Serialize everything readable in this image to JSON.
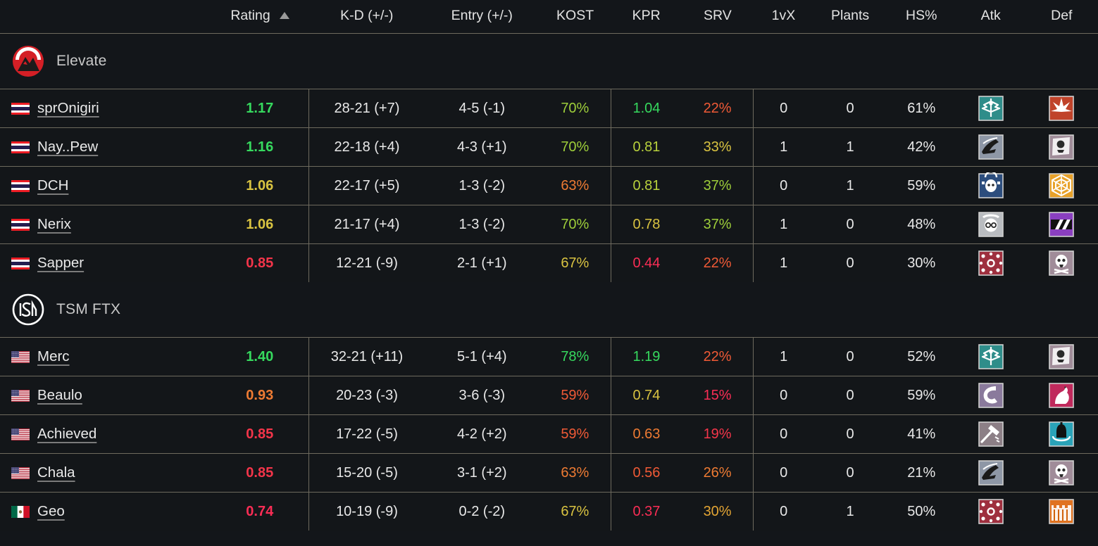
{
  "header": {
    "columns": [
      {
        "key": "name",
        "label": ""
      },
      {
        "key": "rating",
        "label": "Rating",
        "sorted": true,
        "sort_dir": "asc",
        "sort_icon": "sort-arrow-up-icon"
      },
      {
        "key": "kd",
        "label": "K-D (+/-)"
      },
      {
        "key": "entry",
        "label": "Entry (+/-)"
      },
      {
        "key": "kost",
        "label": "KOST"
      },
      {
        "key": "kpr",
        "label": "KPR"
      },
      {
        "key": "srv",
        "label": "SRV"
      },
      {
        "key": "onevx",
        "label": "1vX"
      },
      {
        "key": "plants",
        "label": "Plants"
      },
      {
        "key": "hs",
        "label": "HS%"
      },
      {
        "key": "atk",
        "label": "Atk"
      },
      {
        "key": "def",
        "label": "Def"
      }
    ]
  },
  "colors": {
    "background": "#13161a",
    "row_bg": "#131619",
    "name_cell_bg": "#0e1114",
    "border": "#6e6a5e",
    "text": "#e9e9e9",
    "green": "#36d95e",
    "green_yellow": "#9ece3a",
    "yellow": "#d9c341",
    "amber": "#e3a534",
    "orange": "#ee7b33",
    "orange_red": "#f05a36",
    "red": "#f4354a",
    "pink_red": "#fa2d55"
  },
  "teams": [
    {
      "name": "Elevate",
      "logo": "elevate-logo",
      "logo_colors": {
        "circle": "#d41f26",
        "arc": "#ffffff",
        "mountain": "#1b1b1b"
      },
      "players": [
        {
          "name": "sprOnigiri",
          "flag": "thailand-flag",
          "rating": "1.17",
          "rating_color": "#36d95e",
          "kd": "28-21 (+7)",
          "entry": "4-5 (-1)",
          "kost": "70%",
          "kost_color": "#9ece3a",
          "kpr": "1.04",
          "kpr_color": "#36d95e",
          "srv": "22%",
          "srv_color": "#f05a36",
          "onevx": "0",
          "plants": "0",
          "hs": "61%",
          "atk_op": "valkyrie-icon",
          "atk_bg": "#2f8d8a",
          "atk_glyph": "wings",
          "def_op": "ash-icon",
          "def_bg": "#c0432a",
          "def_glyph": "burst"
        },
        {
          "name": "Nay..Pew",
          "flag": "thailand-flag",
          "rating": "1.16",
          "rating_color": "#36d95e",
          "kd": "22-18 (+4)",
          "entry": "4-3 (+1)",
          "kost": "70%",
          "kost_color": "#9ece3a",
          "kpr": "0.81",
          "kpr_color": "#b8d13c",
          "srv": "33%",
          "srv_color": "#d9c341",
          "onevx": "1",
          "plants": "1",
          "hs": "42%",
          "atk_op": "nomad-icon",
          "atk_bg": "#8e97a6",
          "atk_glyph": "horse",
          "def_op": "caveira-icon",
          "def_bg": "#a08c99",
          "def_glyph": "skullflag"
        },
        {
          "name": "DCH",
          "flag": "thailand-flag",
          "rating": "1.06",
          "rating_color": "#d9c341",
          "kd": "22-17 (+5)",
          "entry": "1-3 (-2)",
          "kost": "63%",
          "kost_color": "#ee7b33",
          "kpr": "0.81",
          "kpr_color": "#b8d13c",
          "srv": "37%",
          "srv_color": "#9ece3a",
          "onevx": "0",
          "plants": "1",
          "hs": "59%",
          "atk_op": "ying-icon",
          "atk_bg": "#2c4d7d",
          "atk_glyph": "skullcan",
          "def_op": "mute-icon",
          "def_bg": "#e8a22a",
          "def_glyph": "web"
        },
        {
          "name": "Nerix",
          "flag": "thailand-flag",
          "rating": "1.06",
          "rating_color": "#d9c341",
          "kd": "21-17 (+4)",
          "entry": "1-3 (-2)",
          "kost": "70%",
          "kost_color": "#9ece3a",
          "kpr": "0.78",
          "kpr_color": "#d9c341",
          "srv": "37%",
          "srv_color": "#9ece3a",
          "onevx": "1",
          "plants": "0",
          "hs": "48%",
          "atk_op": "dokkaebi-icon",
          "atk_bg": "#b9bcc0",
          "atk_glyph": "face",
          "def_op": "mira-icon",
          "def_bg": "#8a3fc0",
          "def_glyph": "stripes"
        },
        {
          "name": "Sapper",
          "flag": "thailand-flag",
          "rating": "0.85",
          "rating_color": "#f4354a",
          "kd": "12-21 (-9)",
          "entry": "2-1 (+1)",
          "kost": "67%",
          "kost_color": "#d9c341",
          "kpr": "0.44",
          "kpr_color": "#fa2d55",
          "srv": "22%",
          "srv_color": "#f05a36",
          "onevx": "1",
          "plants": "0",
          "hs": "30%",
          "atk_op": "thatcher-icon",
          "atk_bg": "#9e2f3e",
          "atk_glyph": "dots",
          "def_op": "frost-icon",
          "def_bg": "#a08c99",
          "def_glyph": "skullbone"
        }
      ]
    },
    {
      "name": "TSM FTX",
      "logo": "tsm-logo",
      "logo_colors": {
        "circle": "#ffffff",
        "mark": "#ffffff"
      },
      "players": [
        {
          "name": "Merc",
          "flag": "usa-flag",
          "rating": "1.40",
          "rating_color": "#36d95e",
          "kd": "32-21 (+11)",
          "entry": "5-1 (+4)",
          "kost": "78%",
          "kost_color": "#36d95e",
          "kpr": "1.19",
          "kpr_color": "#36d95e",
          "srv": "22%",
          "srv_color": "#f05a36",
          "onevx": "1",
          "plants": "0",
          "hs": "52%",
          "atk_op": "valkyrie-icon",
          "atk_bg": "#2f8d8a",
          "atk_glyph": "wings",
          "def_op": "caveira-icon",
          "def_bg": "#a08c99",
          "def_glyph": "skullflag"
        },
        {
          "name": "Beaulo",
          "flag": "usa-flag",
          "rating": "0.93",
          "rating_color": "#ee7b33",
          "kd": "20-23 (-3)",
          "entry": "3-6 (-3)",
          "kost": "59%",
          "kost_color": "#f05a36",
          "kpr": "0.74",
          "kpr_color": "#d9c341",
          "srv": "15%",
          "srv_color": "#fa2d55",
          "onevx": "0",
          "plants": "0",
          "hs": "59%",
          "atk_op": "zofia-icon",
          "atk_bg": "#8a7a9c",
          "atk_glyph": "swirl",
          "def_op": "alibi-icon",
          "def_bg": "#c0295c",
          "def_glyph": "swan"
        },
        {
          "name": "Achieved",
          "flag": "usa-flag",
          "rating": "0.85",
          "rating_color": "#f4354a",
          "kd": "17-22 (-5)",
          "entry": "4-2 (+2)",
          "kost": "59%",
          "kost_color": "#f05a36",
          "kpr": "0.63",
          "kpr_color": "#ee7b33",
          "srv": "19%",
          "srv_color": "#f4354a",
          "onevx": "0",
          "plants": "0",
          "hs": "41%",
          "atk_op": "sledge-icon",
          "atk_bg": "#8c7f86",
          "atk_glyph": "hammer",
          "def_op": "jager-icon",
          "def_bg": "#2aa3b8",
          "def_glyph": "bell"
        },
        {
          "name": "Chala",
          "flag": "usa-flag",
          "rating": "0.85",
          "rating_color": "#f4354a",
          "kd": "15-20 (-5)",
          "entry": "3-1 (+2)",
          "kost": "63%",
          "kost_color": "#ee7b33",
          "kpr": "0.56",
          "kpr_color": "#f05a36",
          "srv": "26%",
          "srv_color": "#ee7b33",
          "onevx": "0",
          "plants": "0",
          "hs": "21%",
          "atk_op": "nomad-icon",
          "atk_bg": "#8e97a6",
          "atk_glyph": "horse",
          "def_op": "frost-icon",
          "def_bg": "#a08c99",
          "def_glyph": "skullbone"
        },
        {
          "name": "Geo",
          "flag": "mexico-flag",
          "rating": "0.74",
          "rating_color": "#fa2d55",
          "kd": "10-19 (-9)",
          "entry": "0-2 (-2)",
          "kost": "67%",
          "kost_color": "#d9c341",
          "kpr": "0.37",
          "kpr_color": "#fa2d55",
          "srv": "30%",
          "srv_color": "#e3a534",
          "onevx": "0",
          "plants": "1",
          "hs": "50%",
          "atk_op": "thatcher-icon",
          "atk_bg": "#9e2f3e",
          "atk_glyph": "dots",
          "def_op": "castle-icon",
          "def_bg": "#e0721f",
          "def_glyph": "castle"
        }
      ]
    }
  ]
}
